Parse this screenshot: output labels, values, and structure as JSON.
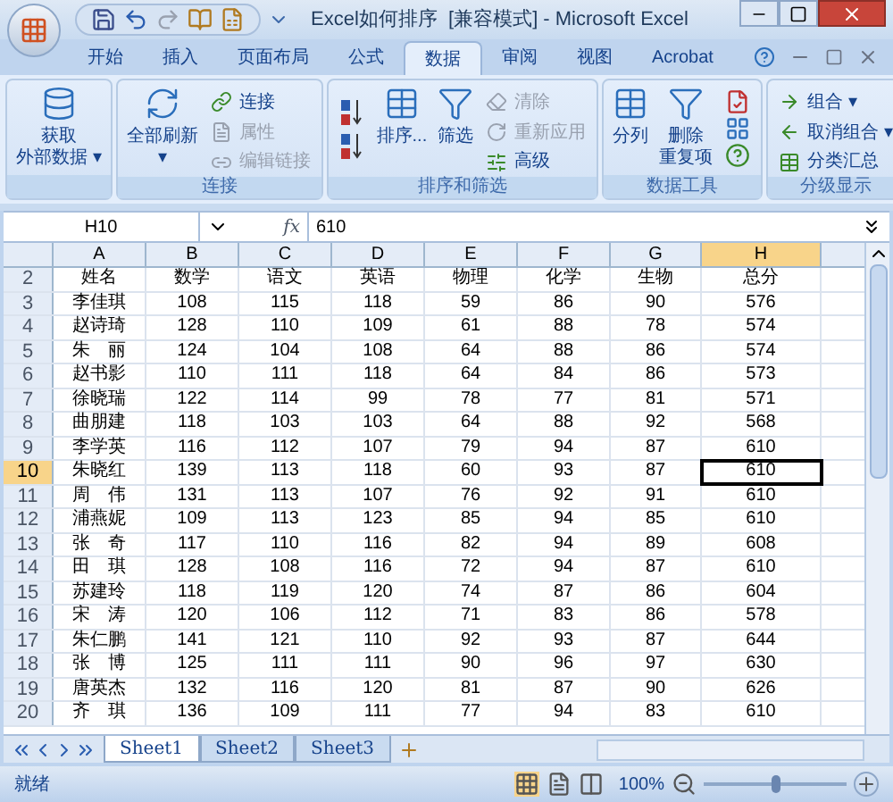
{
  "window": {
    "title": "Excel如何排序  [兼容模式] - Microsoft Excel"
  },
  "tabs": [
    {
      "label": "开始",
      "selected": false
    },
    {
      "label": "插入",
      "selected": false
    },
    {
      "label": "页面布局",
      "selected": false
    },
    {
      "label": "公式",
      "selected": false
    },
    {
      "label": "数据",
      "selected": true
    },
    {
      "label": "审阅",
      "selected": false
    },
    {
      "label": "视图",
      "selected": false
    },
    {
      "label": "Acrobat",
      "selected": false
    }
  ],
  "ribbon": [
    {
      "items": [
        {
          "kind": "large",
          "lines": [
            "获取",
            "外部数据 ▾"
          ]
        }
      ]
    },
    {
      "label": "连接",
      "items": [
        {
          "kind": "large",
          "lines": [
            "全部刷新",
            "▾"
          ]
        },
        {
          "kind": "small",
          "label": "连接",
          "disabled": false
        },
        {
          "kind": "small",
          "label": "属性",
          "disabled": true
        },
        {
          "kind": "small",
          "label": "编辑链接",
          "disabled": true
        }
      ]
    },
    {
      "label": "排序和筛选",
      "items": [
        {
          "kind": "sort"
        },
        {
          "kind": "large",
          "lines": [
            "排序..."
          ]
        },
        {
          "kind": "large",
          "lines": [
            "筛选"
          ]
        },
        {
          "kind": "small",
          "label": "清除",
          "disabled": true
        },
        {
          "kind": "small",
          "label": "重新应用",
          "disabled": true
        },
        {
          "kind": "small",
          "label": "高级",
          "disabled": false
        }
      ]
    },
    {
      "label": "数据工具",
      "items": [
        {
          "kind": "large",
          "lines": [
            "分列"
          ]
        },
        {
          "kind": "large",
          "lines": [
            "删除",
            "重复项"
          ]
        },
        {
          "kind": "tools"
        }
      ]
    },
    {
      "label": "分级显示",
      "items": [
        {
          "kind": "small",
          "label": "组合 ▾",
          "disabled": false
        },
        {
          "kind": "small",
          "label": "取消组合 ▾",
          "disabled": false
        },
        {
          "kind": "small",
          "label": "分类汇总",
          "disabled": false
        }
      ]
    }
  ],
  "formula_bar": {
    "name_box": "H10",
    "function_label": "fx",
    "value": "610"
  },
  "columns": [
    {
      "label": "A",
      "selected": false
    },
    {
      "label": "B",
      "selected": false
    },
    {
      "label": "C",
      "selected": false
    },
    {
      "label": "D",
      "selected": false
    },
    {
      "label": "E",
      "selected": false
    },
    {
      "label": "F",
      "selected": false
    },
    {
      "label": "G",
      "selected": false
    },
    {
      "label": "H",
      "selected": true
    }
  ],
  "rows": [
    {
      "header": "2",
      "selected": false,
      "cells": [
        "姓名",
        "数学",
        "语文",
        "英语",
        "物理",
        "化学",
        "生物",
        "总分"
      ]
    },
    {
      "header": "3",
      "selected": false,
      "cells": [
        "李佳琪",
        "108",
        "115",
        "118",
        "59",
        "86",
        "90",
        "576"
      ]
    },
    {
      "header": "4",
      "selected": false,
      "cells": [
        "赵诗琦",
        "128",
        "110",
        "109",
        "61",
        "88",
        "78",
        "574"
      ]
    },
    {
      "header": "5",
      "selected": false,
      "cells": [
        "朱　丽",
        "124",
        "104",
        "108",
        "64",
        "88",
        "86",
        "574"
      ]
    },
    {
      "header": "6",
      "selected": false,
      "cells": [
        "赵书影",
        "110",
        "111",
        "118",
        "64",
        "84",
        "86",
        "573"
      ]
    },
    {
      "header": "7",
      "selected": false,
      "cells": [
        "徐晓瑞",
        "122",
        "114",
        "99",
        "78",
        "77",
        "81",
        "571"
      ]
    },
    {
      "header": "8",
      "selected": false,
      "cells": [
        "曲朋建",
        "118",
        "103",
        "103",
        "64",
        "88",
        "92",
        "568"
      ]
    },
    {
      "header": "9",
      "selected": false,
      "cells": [
        "李学英",
        "116",
        "112",
        "107",
        "79",
        "94",
        "87",
        "610"
      ]
    },
    {
      "header": "10",
      "selected": true,
      "cells": [
        "朱晓红",
        "139",
        "113",
        "118",
        "60",
        "93",
        "87",
        "610"
      ]
    },
    {
      "header": "11",
      "selected": false,
      "cells": [
        "周　伟",
        "131",
        "113",
        "107",
        "76",
        "92",
        "91",
        "610"
      ]
    },
    {
      "header": "12",
      "selected": false,
      "cells": [
        "浦燕妮",
        "109",
        "113",
        "123",
        "85",
        "94",
        "85",
        "610"
      ]
    },
    {
      "header": "13",
      "selected": false,
      "cells": [
        "张　奇",
        "117",
        "110",
        "116",
        "82",
        "94",
        "89",
        "608"
      ]
    },
    {
      "header": "14",
      "selected": false,
      "cells": [
        "田　琪",
        "128",
        "108",
        "116",
        "72",
        "94",
        "87",
        "610"
      ]
    },
    {
      "header": "15",
      "selected": false,
      "cells": [
        "苏建玲",
        "118",
        "119",
        "120",
        "74",
        "87",
        "86",
        "604"
      ]
    },
    {
      "header": "16",
      "selected": false,
      "cells": [
        "宋　涛",
        "120",
        "106",
        "112",
        "71",
        "83",
        "86",
        "578"
      ]
    },
    {
      "header": "17",
      "selected": false,
      "cells": [
        "朱仁鹏",
        "141",
        "121",
        "110",
        "92",
        "93",
        "87",
        "644"
      ]
    },
    {
      "header": "18",
      "selected": false,
      "cells": [
        "张　博",
        "125",
        "111",
        "111",
        "90",
        "96",
        "97",
        "630"
      ]
    },
    {
      "header": "19",
      "selected": false,
      "cells": [
        "唐英杰",
        "132",
        "116",
        "120",
        "81",
        "87",
        "90",
        "626"
      ]
    },
    {
      "header": "20",
      "selected": false,
      "cells": [
        "齐　琪",
        "136",
        "109",
        "111",
        "77",
        "94",
        "83",
        "610"
      ]
    }
  ],
  "sheets": [
    {
      "label": "Sheet1",
      "selected": true
    },
    {
      "label": "Sheet2",
      "selected": false
    },
    {
      "label": "Sheet3",
      "selected": false
    }
  ],
  "status_bar": {
    "text": "就绪",
    "zoom": "100%",
    "zoom_slider": {
      "level": 0.5
    }
  }
}
